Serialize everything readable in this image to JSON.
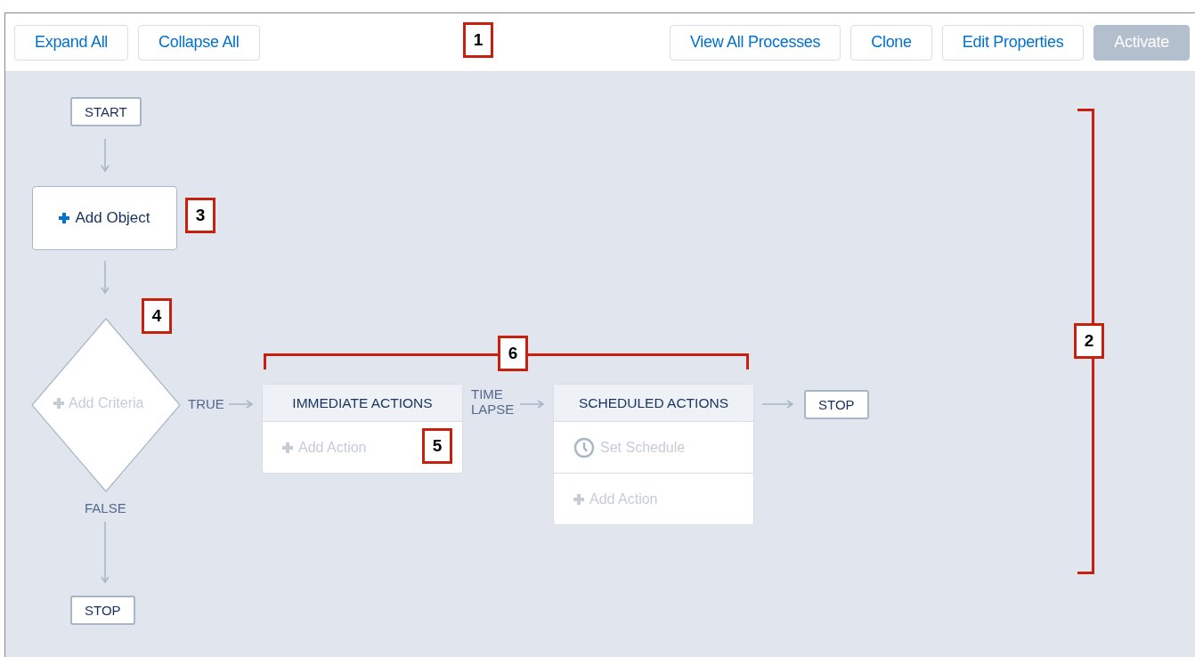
{
  "toolbar": {
    "left_buttons": [
      {
        "label": "Expand All",
        "disabled": false
      },
      {
        "label": "Collapse All",
        "disabled": false
      }
    ],
    "right_buttons": [
      {
        "label": "View All Processes",
        "disabled": false
      },
      {
        "label": "Clone",
        "disabled": false
      },
      {
        "label": "Edit Properties",
        "disabled": false
      },
      {
        "label": "Activate",
        "disabled": true
      }
    ]
  },
  "canvas": {
    "start": "START",
    "object_node": {
      "label": "Add Object"
    },
    "criteria_node": {
      "label": "Add Criteria"
    },
    "true_label": "TRUE",
    "false_label": "FALSE",
    "false_stop": "STOP",
    "immediate_actions": {
      "title": "IMMEDIATE ACTIONS",
      "items": [
        {
          "kind": "add",
          "label": "Add Action"
        }
      ]
    },
    "time_lapse_label": "TIME\nLAPSE",
    "scheduled_actions": {
      "title": "SCHEDULED ACTIONS",
      "items": [
        {
          "kind": "schedule",
          "label": "Set Schedule"
        },
        {
          "kind": "add",
          "label": "Add Action"
        }
      ]
    },
    "end_stop": "STOP"
  },
  "callouts": [
    {
      "number": "1",
      "kind": "box"
    },
    {
      "number": "2",
      "kind": "vertical-bracket"
    },
    {
      "number": "3",
      "kind": "box"
    },
    {
      "number": "4",
      "kind": "box"
    },
    {
      "number": "5",
      "kind": "box"
    },
    {
      "number": "6",
      "kind": "horizontal-bracket"
    }
  ]
}
